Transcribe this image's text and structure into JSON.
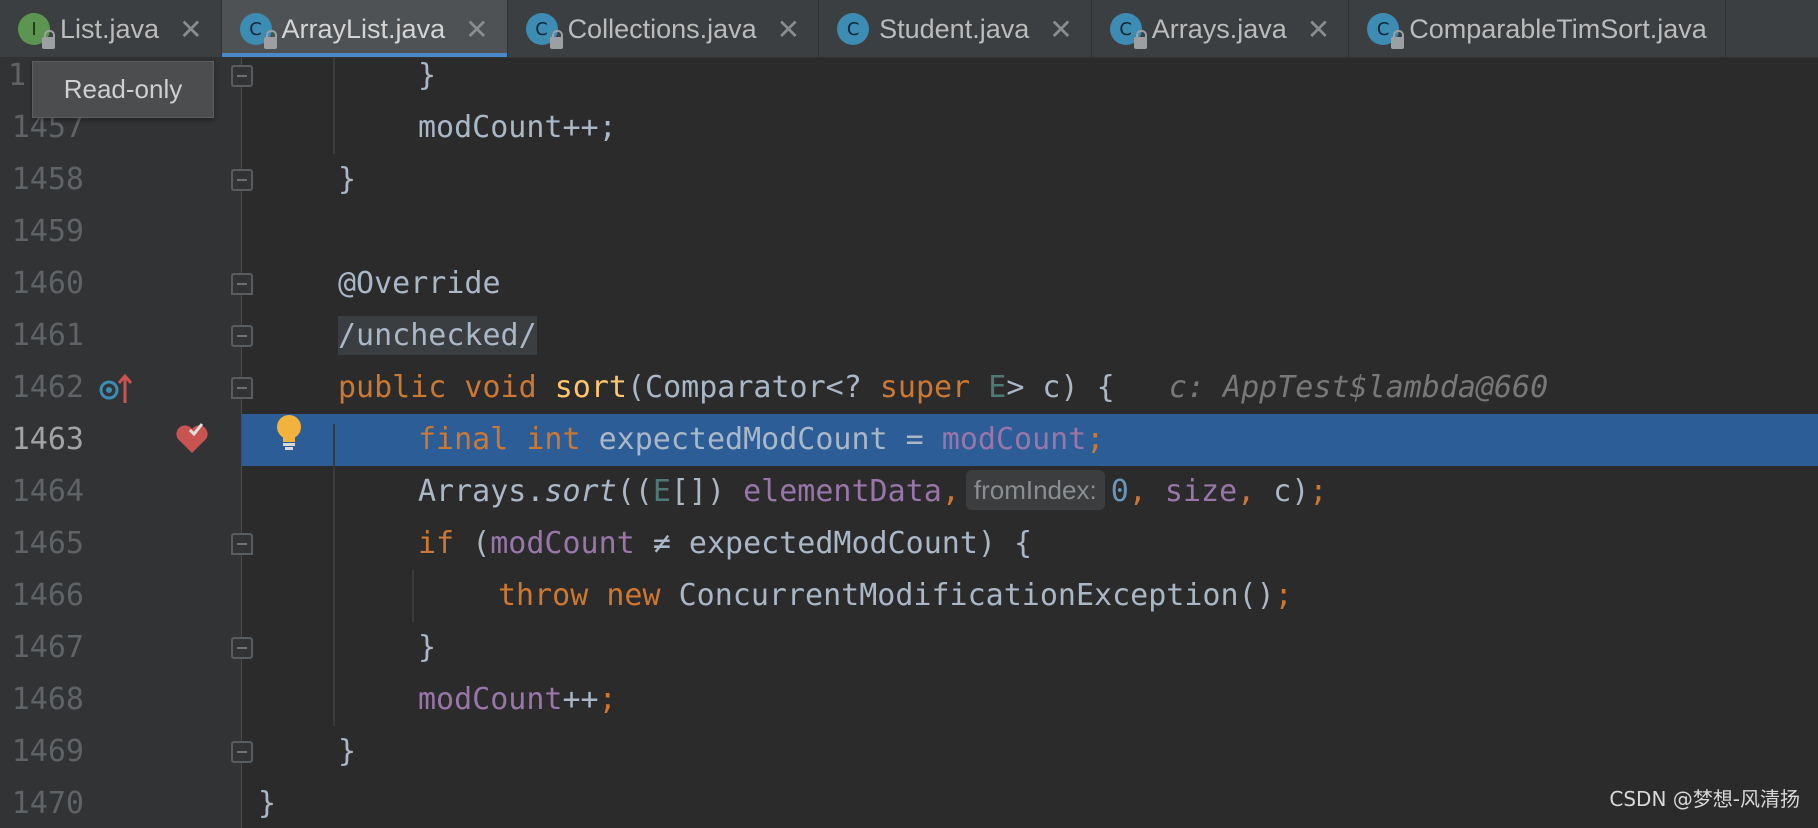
{
  "tabs": [
    {
      "label": "List.java",
      "icon": "interface-icon",
      "icon_letter": "I",
      "active": false
    },
    {
      "label": "ArrayList.java",
      "icon": "class-icon",
      "icon_letter": "C",
      "active": true
    },
    {
      "label": "Collections.java",
      "icon": "class-icon",
      "icon_letter": "C",
      "active": false
    },
    {
      "label": "Student.java",
      "icon": "class-icon",
      "icon_letter": "C",
      "active": false
    },
    {
      "label": "Arrays.java",
      "icon": "class-icon",
      "icon_letter": "C",
      "active": false
    },
    {
      "label": "ComparableTimSort.java",
      "icon": "class-icon",
      "icon_letter": "C",
      "active": false
    }
  ],
  "tab_close_glyph": "✕",
  "tooltip": "Read-only",
  "tooltip_line_prefix": "1",
  "editor": {
    "current_line": 1463,
    "lines": [
      {
        "number": "1457",
        "text": "modCount++;"
      },
      {
        "number": "1458",
        "text": "}"
      },
      {
        "number": "1459",
        "text": ""
      },
      {
        "number": "1460",
        "text": "@Override"
      },
      {
        "number": "1461",
        "text": "/unchecked/"
      },
      {
        "number": "1462",
        "text": "public void sort(Comparator<? super E> c) {"
      },
      {
        "number": "1463",
        "text": "final int expectedModCount = modCount;"
      },
      {
        "number": "1464",
        "text": "Arrays.sort((E[]) elementData, 0, size, c);"
      },
      {
        "number": "1465",
        "text": "if (modCount ≠ expectedModCount) {"
      },
      {
        "number": "1466",
        "text": "throw new ConcurrentModificationException();"
      },
      {
        "number": "1467",
        "text": "}"
      },
      {
        "number": "1468",
        "text": "modCount++;"
      },
      {
        "number": "1469",
        "text": "}"
      },
      {
        "number": "1470",
        "text": "}"
      }
    ],
    "first_line_text": "}",
    "inline_debug_value": "c: AppTest$lambda@660",
    "parameter_hint": "fromIndex:"
  },
  "colors": {
    "background": "#2b2b2b",
    "selection": "#2d5d96",
    "keyword": "#cc7832",
    "field": "#9876aa",
    "method": "#ffc66d",
    "annotation": "#bbb529",
    "number": "#6897bb"
  },
  "watermark": "CSDN @梦想-风清扬"
}
